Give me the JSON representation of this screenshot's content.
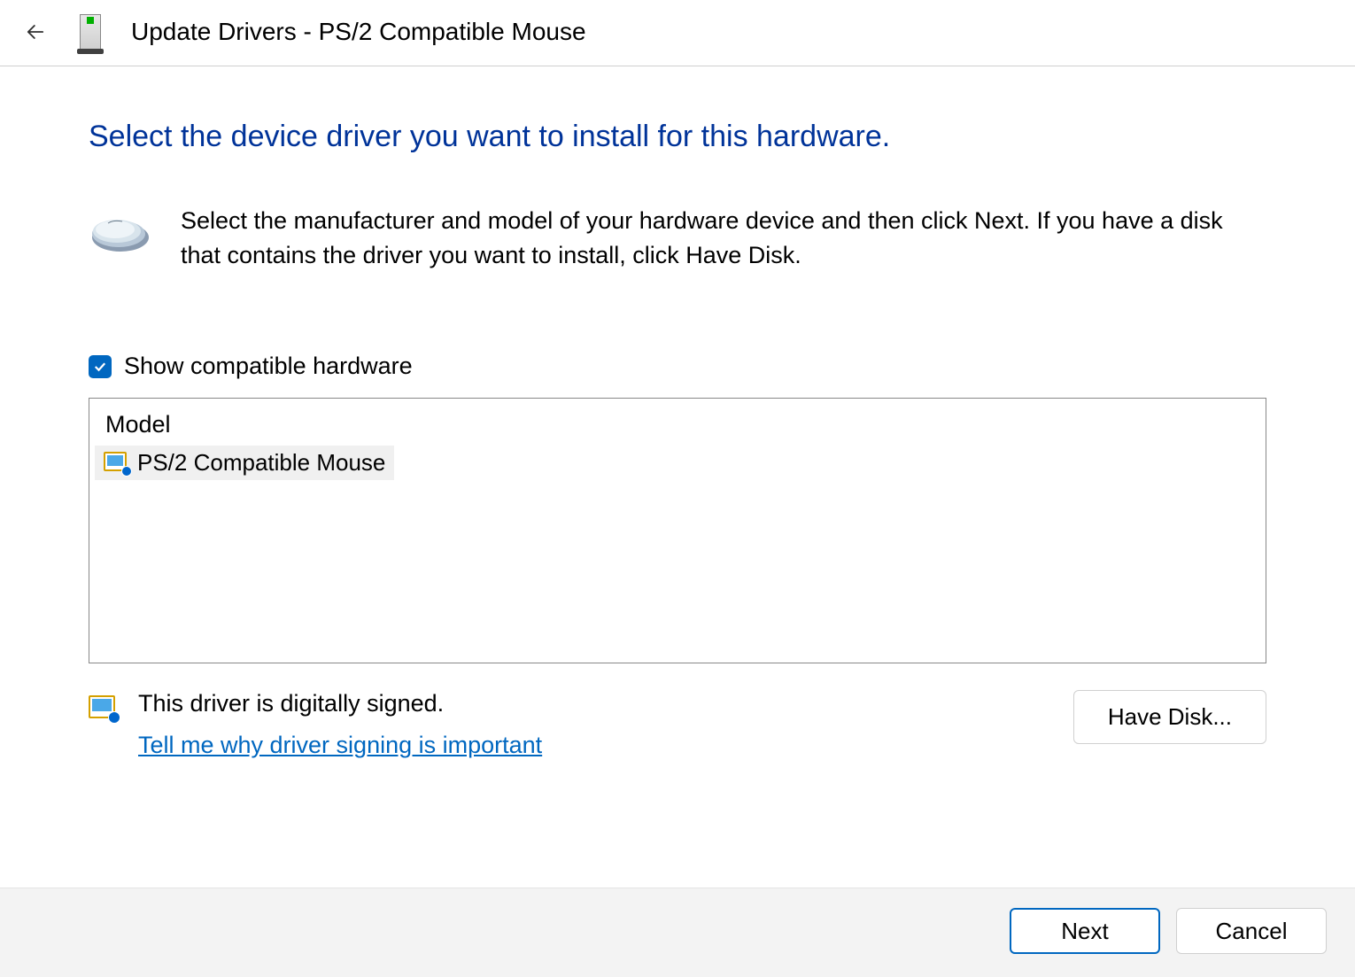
{
  "titlebar": {
    "title": "Update Drivers - PS/2 Compatible Mouse"
  },
  "content": {
    "heading": "Select the device driver you want to install for this hardware.",
    "instruction": "Select the manufacturer and model of your hardware device and then click Next. If you have a disk that contains the driver you want to install, click Have Disk.",
    "checkbox_label": "Show compatible hardware",
    "checkbox_checked": true,
    "list_header": "Model",
    "list_items": [
      {
        "label": "PS/2 Compatible Mouse"
      }
    ],
    "signed_text": "This driver is digitally signed.",
    "signing_link": "Tell me why driver signing is important",
    "have_disk_label": "Have Disk..."
  },
  "footer": {
    "next_label": "Next",
    "cancel_label": "Cancel"
  }
}
